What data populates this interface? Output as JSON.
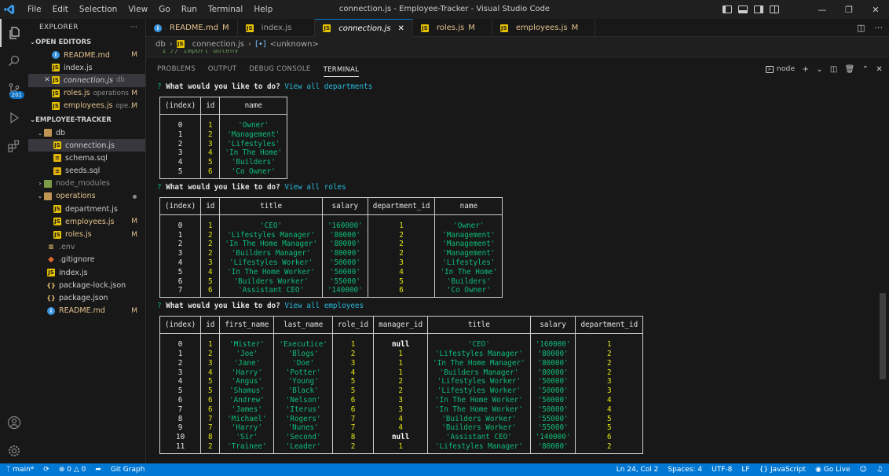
{
  "window": {
    "title": "connection.js - Employee-Tracker - Visual Studio Code",
    "menu": [
      "File",
      "Edit",
      "Selection",
      "View",
      "Go",
      "Run",
      "Terminal",
      "Help"
    ]
  },
  "activity": {
    "source_control_badge": "201"
  },
  "sidebar": {
    "header": "EXPLORER",
    "open_editors_label": "OPEN EDITORS",
    "open_editors": [
      {
        "name": "README.md",
        "icon": "md",
        "status": "M",
        "desc": ""
      },
      {
        "name": "index.js",
        "icon": "js",
        "status": "",
        "desc": ""
      },
      {
        "name": "connection.js",
        "icon": "js",
        "status": "",
        "desc": "db"
      },
      {
        "name": "roles.js",
        "icon": "js",
        "status": "M",
        "desc": "operations"
      },
      {
        "name": "employees.js",
        "icon": "js",
        "status": "M",
        "desc": "ope..."
      }
    ],
    "project_label": "EMPLOYEE-TRACKER",
    "tree": {
      "db": "db",
      "connection": "connection.js",
      "schema": "schema.sql",
      "seeds": "seeds.sql",
      "node_modules": "node_modules",
      "operations": "operations",
      "department": "department.js",
      "employees": "employees.js",
      "roles": "roles.js",
      "env": ".env",
      "gitignore": ".gitignore",
      "index": "index.js",
      "package_lock": "package-lock.json",
      "package": "package.json",
      "readme": "README.md",
      "mod_status": "M"
    }
  },
  "tabs": [
    {
      "label": "README.md",
      "status": "M"
    },
    {
      "label": "index.js",
      "status": ""
    },
    {
      "label": "connection.js",
      "status": ""
    },
    {
      "label": "roles.js",
      "status": "M"
    },
    {
      "label": "employees.js",
      "status": "M"
    }
  ],
  "breadcrumb": {
    "folder": "db",
    "file": "connection.js",
    "symbol": "<unknown>"
  },
  "code_peek": "1      // import dotenv",
  "panel": {
    "tabs": [
      "PROBLEMS",
      "OUTPUT",
      "DEBUG CONSOLE",
      "TERMINAL"
    ],
    "terminal_name": "node"
  },
  "terminal": {
    "prompt_q": "?",
    "prompt_text": "What would you like to do?",
    "answers": [
      "View all departments",
      "View all roles",
      "View all employees"
    ],
    "departments": {
      "headers": [
        "(index)",
        "id",
        "name"
      ],
      "rows": [
        [
          "0",
          "1",
          "'Owner'"
        ],
        [
          "1",
          "2",
          "'Management'"
        ],
        [
          "2",
          "3",
          "'Lifestyles'"
        ],
        [
          "3",
          "4",
          "'In The Home'"
        ],
        [
          "4",
          "5",
          "'Builders'"
        ],
        [
          "5",
          "6",
          "'Co Owner'"
        ]
      ]
    },
    "roles": {
      "headers": [
        "(index)",
        "id",
        "title",
        "salary",
        "department_id",
        "name"
      ],
      "rows": [
        [
          "0",
          "1",
          "'CEO'",
          "'160000'",
          "1",
          "'Owner'"
        ],
        [
          "1",
          "2",
          "'Lifestyles Manager'",
          "'80000'",
          "2",
          "'Management'"
        ],
        [
          "2",
          "2",
          "'In The Home Manager'",
          "'80000'",
          "2",
          "'Management'"
        ],
        [
          "3",
          "2",
          "'Builders Manager'",
          "'80000'",
          "2",
          "'Management'"
        ],
        [
          "4",
          "3",
          "'Lifestyles Worker'",
          "'50000'",
          "3",
          "'Lifestyles'"
        ],
        [
          "5",
          "4",
          "'In The Home Worker'",
          "'50000'",
          "4",
          "'In The Home'"
        ],
        [
          "6",
          "5",
          "'Builders Worker'",
          "'55000'",
          "5",
          "'Builders'"
        ],
        [
          "7",
          "6",
          "'Assistant CEO'",
          "'140000'",
          "6",
          "'Co Owner'"
        ]
      ]
    },
    "employees": {
      "headers": [
        "(index)",
        "id",
        "first_name",
        "last_name",
        "role_id",
        "manager_id",
        "title",
        "salary",
        "department_id"
      ],
      "rows": [
        [
          "0",
          "1",
          "'Mister'",
          "'Executice'",
          "1",
          "null",
          "'CEO'",
          "'160000'",
          "1"
        ],
        [
          "1",
          "2",
          "'Joe'",
          "'Blogs'",
          "2",
          "1",
          "'Lifestyles Manager'",
          "'80000'",
          "2"
        ],
        [
          "2",
          "3",
          "'Jane'",
          "'Doe'",
          "3",
          "1",
          "'In The Home Manager'",
          "'80000'",
          "2"
        ],
        [
          "3",
          "4",
          "'Harry'",
          "'Potter'",
          "4",
          "1",
          "'Builders Manager'",
          "'80000'",
          "2"
        ],
        [
          "4",
          "5",
          "'Angus'",
          "'Young'",
          "5",
          "2",
          "'Lifestyles Worker'",
          "'50000'",
          "3"
        ],
        [
          "5",
          "5",
          "'Shamus'",
          "'Black'",
          "5",
          "2",
          "'Lifestyles Worker'",
          "'50000'",
          "3"
        ],
        [
          "6",
          "6",
          "'Andrew'",
          "'Nelson'",
          "6",
          "3",
          "'In The Home Worker'",
          "'50000'",
          "4"
        ],
        [
          "7",
          "6",
          "'James'",
          "'Iterus'",
          "6",
          "3",
          "'In The Home Worker'",
          "'50000'",
          "4"
        ],
        [
          "8",
          "7",
          "'Michael'",
          "'Rogers'",
          "7",
          "4",
          "'Builders Worker'",
          "'55000'",
          "5"
        ],
        [
          "9",
          "7",
          "'Harry'",
          "'Nunes'",
          "7",
          "4",
          "'Builders Worker'",
          "'55000'",
          "5"
        ],
        [
          "10",
          "8",
          "'Sir'",
          "'Second'",
          "8",
          "null",
          "'Assistant CEO'",
          "'140000'",
          "6"
        ],
        [
          "11",
          "2",
          "'Trainee'",
          "'Leader'",
          "2",
          "1",
          "'Lifestyles Manager'",
          "'80000'",
          "2"
        ]
      ]
    }
  },
  "status": {
    "branch": "main*",
    "errors": "0",
    "warnings": "0",
    "git_graph": "Git Graph",
    "position": "Ln 24, Col 2",
    "spaces": "Spaces: 4",
    "encoding": "UTF-8",
    "eol": "LF",
    "language": "JavaScript",
    "go_live": "Go Live"
  },
  "colors": {
    "accent": "#0078d4",
    "string": "#0dbc79",
    "number": "#e5e510",
    "link": "#29b8db",
    "modified": "#e2c08d"
  }
}
